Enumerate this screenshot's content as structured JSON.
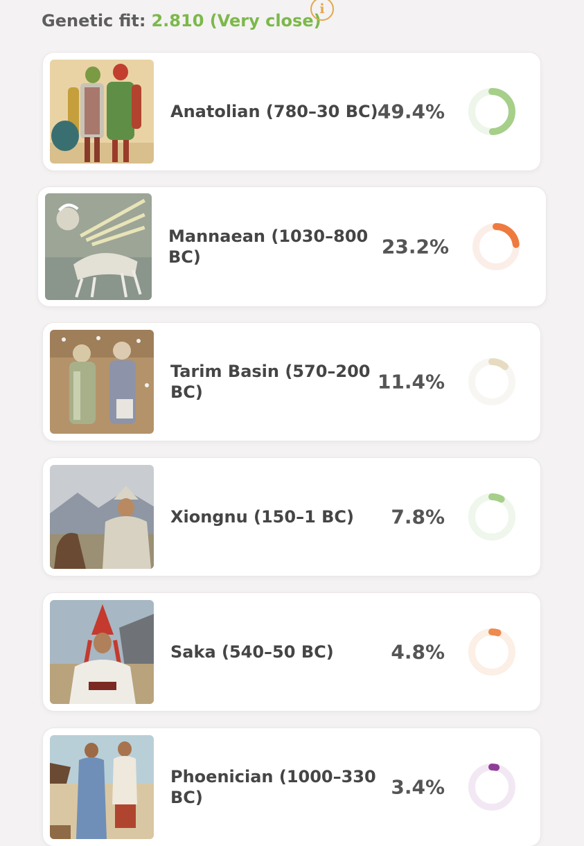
{
  "header": {
    "fit_label": "Genetic fit:",
    "fit_value": "2.810 (Very close)",
    "info_icon": "info-icon",
    "info_glyph": "i",
    "accent_color": "#7cb84a"
  },
  "populations": [
    {
      "name": "Anatolian (780–30 BC)",
      "percent": "49.4%",
      "share": 49.4,
      "color": "#a6cf8a",
      "track": "#eef5ea"
    },
    {
      "name": "Mannaean (1030–800 BC)",
      "percent": "23.2%",
      "share": 23.2,
      "color": "#ee7a3f",
      "track": "#fbeee8"
    },
    {
      "name": "Tarim Basin (570–200 BC)",
      "percent": "11.4%",
      "share": 11.4,
      "color": "#e6dcc2",
      "track": "#f8f6f2"
    },
    {
      "name": "Xiongnu (150–1 BC)",
      "percent": "7.8%",
      "share": 7.8,
      "color": "#a6cf8a",
      "track": "#eff6ec"
    },
    {
      "name": "Saka (540–50 BC)",
      "percent": "4.8%",
      "share": 4.8,
      "color": "#ee8b4e",
      "track": "#fbefe6"
    },
    {
      "name": "Phoenician (1000–330 BC)",
      "percent": "3.4%",
      "share": 3.4,
      "color": "#8e3e98",
      "track": "#f2e8f3"
    }
  ]
}
